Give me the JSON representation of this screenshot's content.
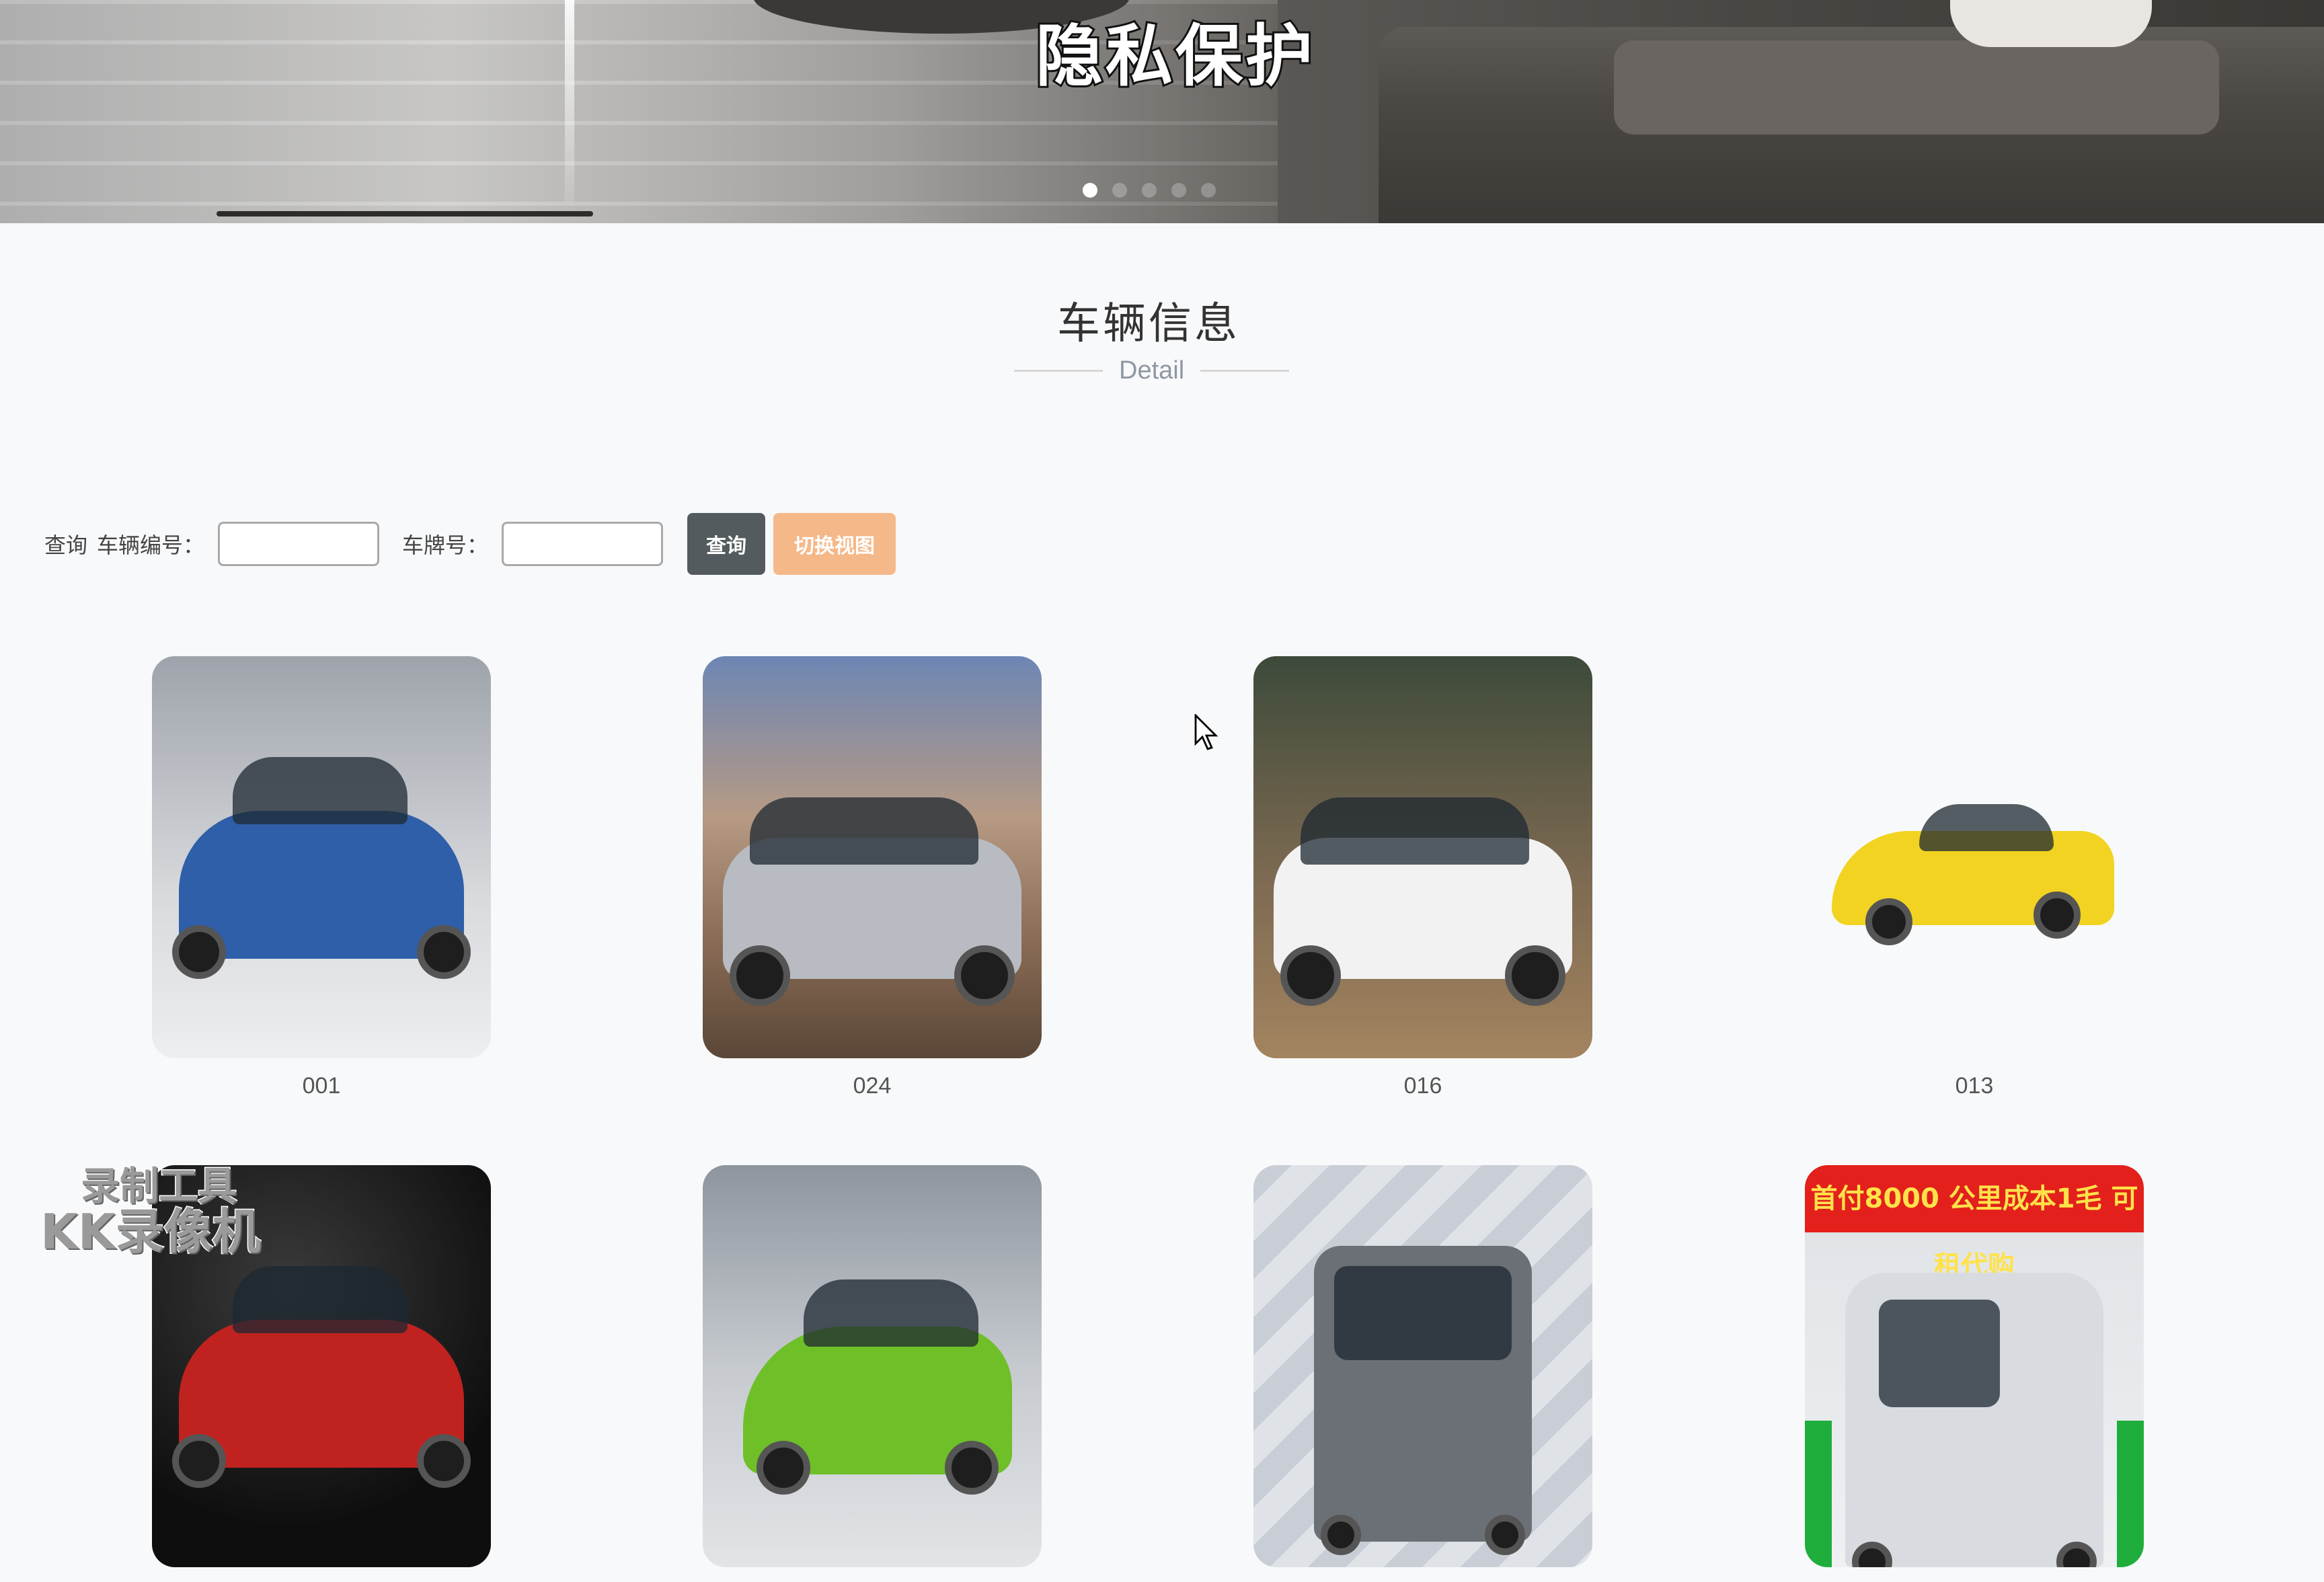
{
  "banner": {
    "caption": "隐私保护",
    "slides": [
      {
        "active": true
      },
      {
        "active": false
      },
      {
        "active": false
      },
      {
        "active": false
      },
      {
        "active": false
      }
    ]
  },
  "section": {
    "title": "车辆信息",
    "subtitle": "Detail"
  },
  "search": {
    "label_prefix": "查询",
    "vehicle_no_label": "车辆编号：",
    "vehicle_no_value": "",
    "plate_label": "车牌号：",
    "plate_value": "",
    "query_button": "查询",
    "switch_view_button": "切换视图"
  },
  "cars": [
    {
      "code": "001",
      "color": "#2f5fa8",
      "kind": "sports"
    },
    {
      "code": "024",
      "color": "#b8bcc2",
      "kind": "suv"
    },
    {
      "code": "016",
      "color": "#f2f2f2",
      "kind": "suv"
    },
    {
      "code": "013",
      "color": "#f2d321",
      "kind": "sports"
    },
    {
      "code": "",
      "color": "#c0231f",
      "kind": "sports"
    },
    {
      "code": "",
      "color": "#6fbf28",
      "kind": "hatch"
    },
    {
      "code": "",
      "color": "#6b6f76",
      "kind": "van"
    },
    {
      "code": "",
      "color": "#d8dbe0",
      "kind": "bus",
      "ad_text": "首付8000 公里成本1毛 可租代购"
    }
  ],
  "watermark": {
    "line1": "录制工具",
    "line2": "KK录像机"
  }
}
